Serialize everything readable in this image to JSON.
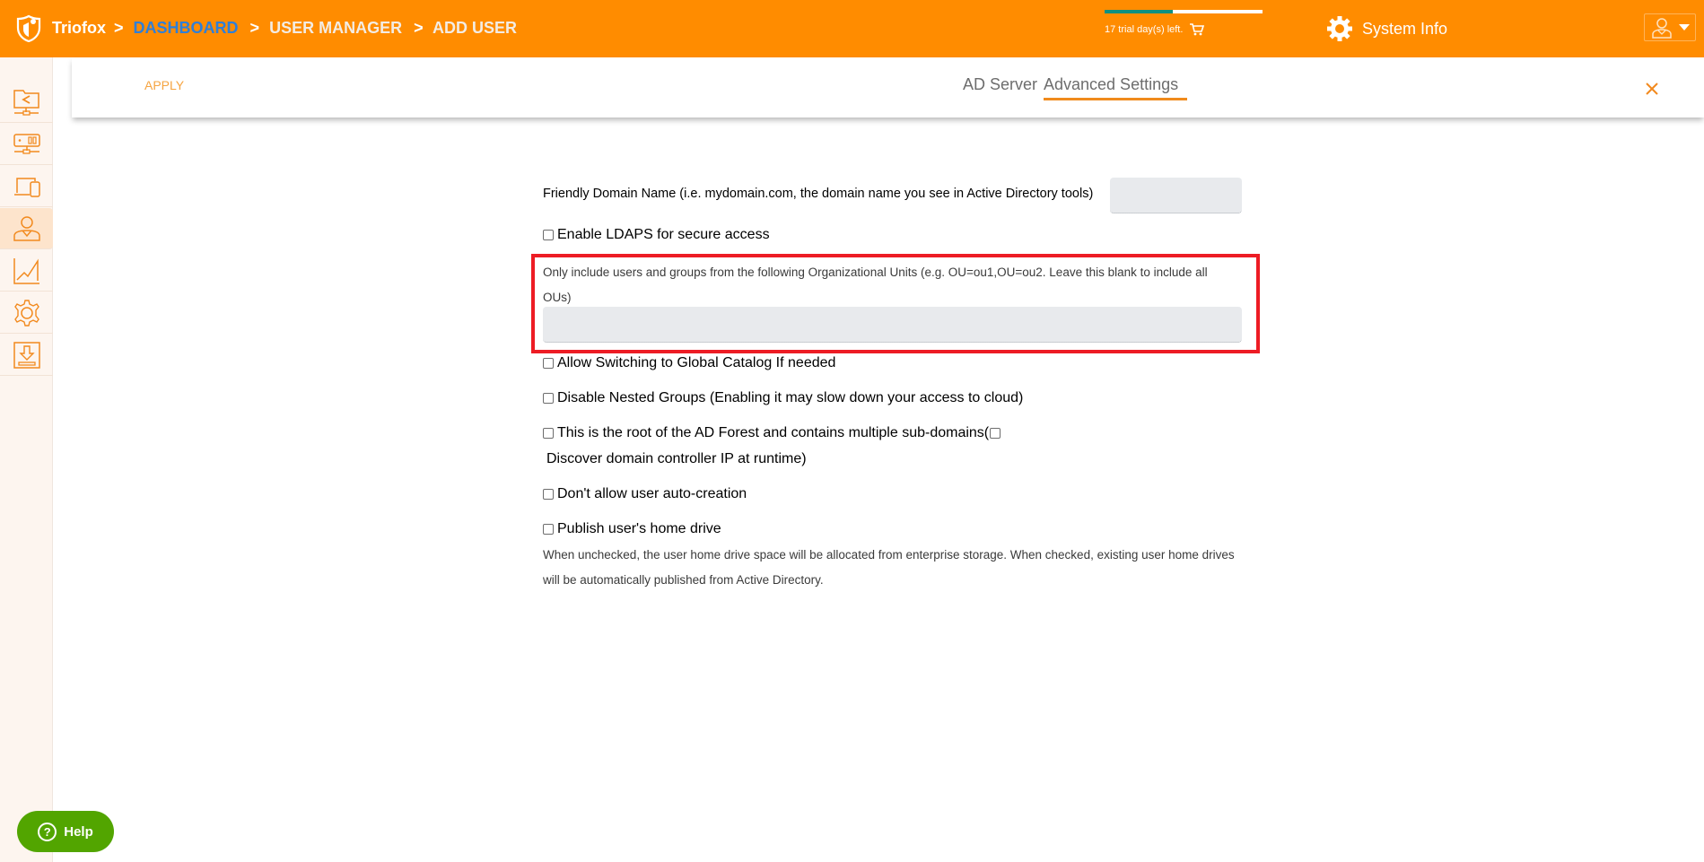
{
  "header": {
    "brand": "Triofox",
    "breadcrumb": [
      {
        "label": "DASHBOARD",
        "link": true
      },
      {
        "label": "USER MANAGER",
        "link": false
      },
      {
        "label": "ADD USER",
        "link": false
      }
    ],
    "separator": ">",
    "trial": {
      "text": "17 trial day(s) left.",
      "progress_fraction": 0.43
    },
    "system_info_label": "System Info"
  },
  "sidebar": {
    "items": [
      {
        "icon": "shared-folder-icon",
        "active": false
      },
      {
        "icon": "server-icon",
        "active": false
      },
      {
        "icon": "devices-icon",
        "active": false
      },
      {
        "icon": "user-icon",
        "active": true
      },
      {
        "icon": "chart-icon",
        "active": false
      },
      {
        "icon": "settings-icon",
        "active": false
      },
      {
        "icon": "download-icon",
        "active": false
      }
    ]
  },
  "toolbar": {
    "apply_label": "APPLY",
    "tabs": [
      {
        "label": "AD Server",
        "active": false
      },
      {
        "label": "Advanced Settings",
        "active": true
      }
    ]
  },
  "form": {
    "friendly_domain_label": "Friendly Domain Name (i.e. mydomain.com, the domain name you see in Active Directory tools)",
    "friendly_domain_value": "",
    "enable_ldaps_label": "Enable LDAPS for secure access",
    "ou_label": "Only include users and groups from the following Organizational Units (e.g. OU=ou1,OU=ou2. Leave this blank to include all OUs)",
    "ou_value": "",
    "global_catalog_label": "Allow Switching to Global Catalog If needed",
    "nested_groups_label": "Disable Nested Groups (Enabling it may slow down your access to cloud)",
    "ad_forest_label": "This is the root of the AD Forest and contains multiple sub-domains(",
    "discover_dc_label": "Discover domain controller IP at runtime)",
    "auto_creation_label": "Don't allow user auto-creation",
    "home_drive_label": "Publish user's home drive",
    "home_drive_note": "When unchecked, the user home drive space will be allocated from enterprise storage. When checked, existing user home drives will be automatically published from Active Directory.",
    "checkboxes": {
      "enable_ldaps": false,
      "global_catalog": false,
      "nested_groups": false,
      "ad_forest": false,
      "discover_dc": false,
      "auto_creation": false,
      "home_drive": false
    }
  },
  "help": {
    "label": "Help"
  },
  "colors": {
    "brand_orange": "#ff8c00",
    "highlight_red": "#ed1c24",
    "help_green": "#52a500",
    "link_blue": "#2f7fd8",
    "trial_teal": "#0e9080"
  }
}
